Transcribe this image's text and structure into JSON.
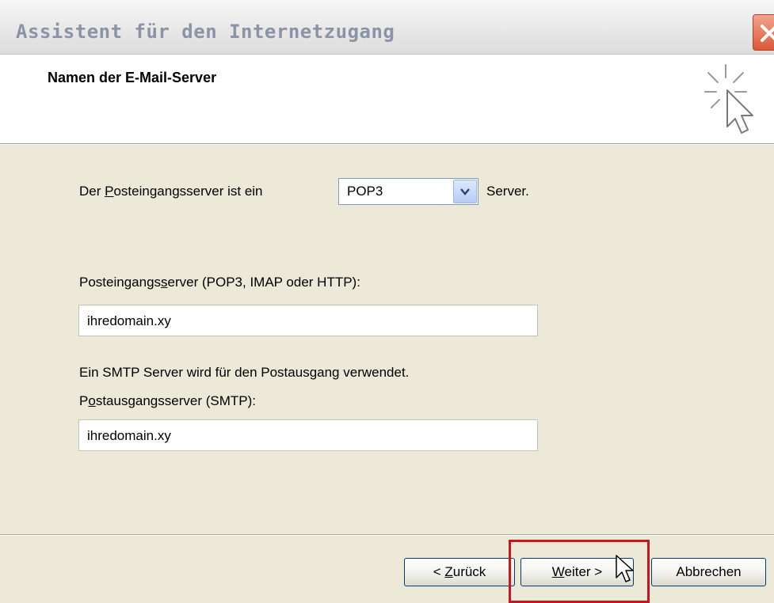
{
  "window": {
    "title": "Assistent für den Internetzugang"
  },
  "header": {
    "title": "Namen der E-Mail-Server",
    "icon": "wizard-cursor-icon"
  },
  "server_type": {
    "label_before": "Der ",
    "label_access_key": "P",
    "label_after": "osteingangsserver ist ein",
    "selected": "POP3",
    "suffix": "Server."
  },
  "incoming": {
    "label_before": "Posteingangs",
    "label_access_key": "s",
    "label_after": "erver (POP3, IMAP oder HTTP):",
    "value": "ihredomain.xy"
  },
  "smtp_note": "Ein SMTP Server wird für den Postausgang verwendet.",
  "outgoing": {
    "label_before": "P",
    "label_access_key": "o",
    "label_after": "stausgangsserver (SMTP):",
    "value": "ihredomain.xy"
  },
  "buttons": {
    "back_prefix": "< ",
    "back_key": "Z",
    "back_rest": "urück",
    "next_key": "W",
    "next_rest": "eiter >",
    "cancel": "Abbrechen"
  },
  "colors": {
    "highlight": "#c8161e",
    "dialog_bg": "#ece9d8"
  }
}
